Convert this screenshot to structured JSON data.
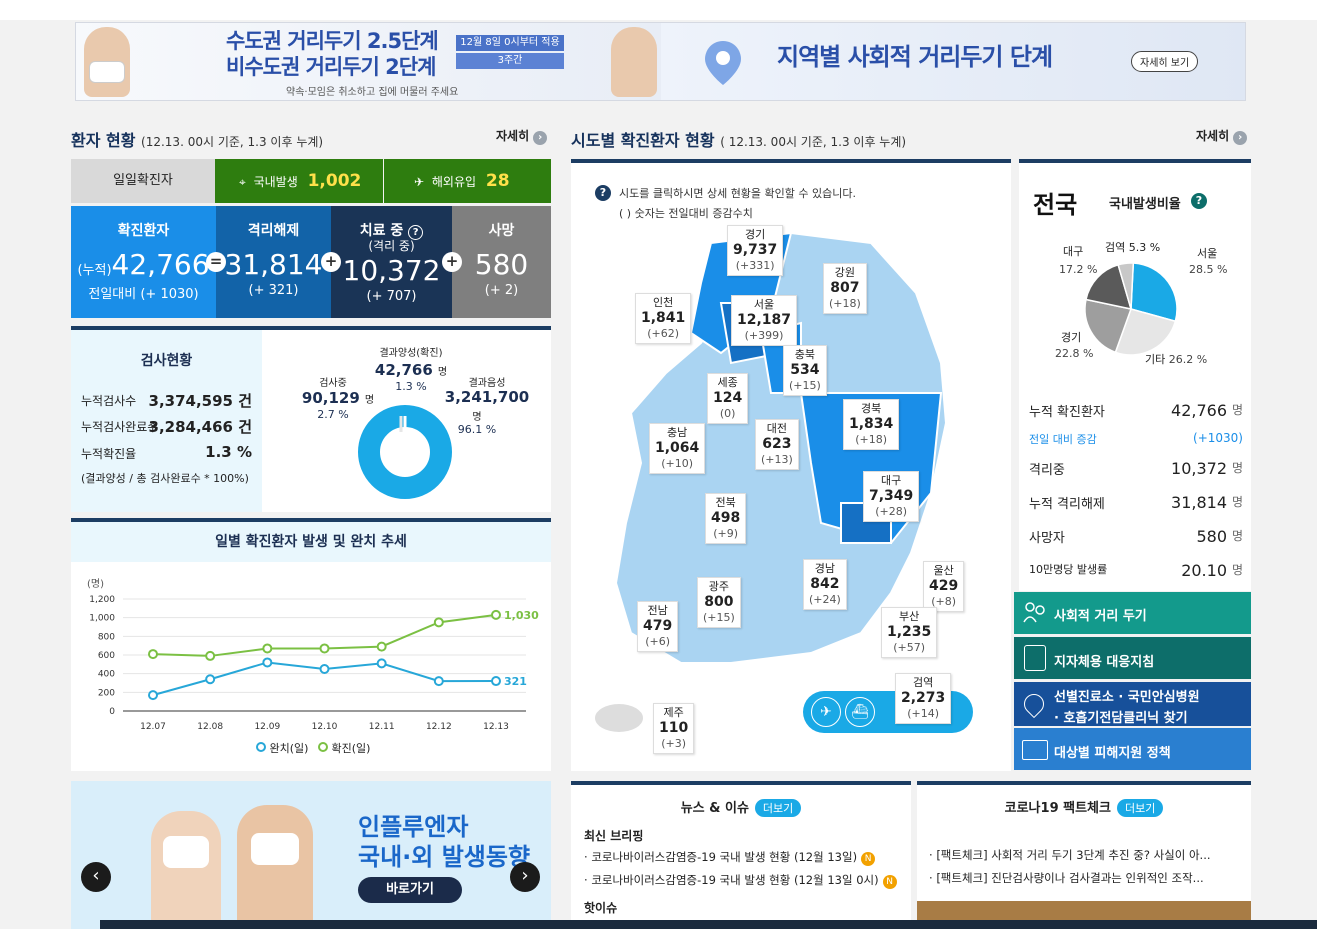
{
  "banner": {
    "left_title_1": "수도권 거리두기 2.5단계",
    "left_title_2": "비수도권 거리두기 2단계",
    "left_subtitle": "약속·모임은 취소하고 집에 머물러 주세요",
    "left_box_1": "12월 8일 0시부터 적용",
    "left_box_2": "3주간",
    "right_title": "지역별 사회적 거리두기 단계",
    "right_more": "자세히 보기"
  },
  "patient_status": {
    "title": "환자 현황",
    "subtitle": "(12.13. 00시 기준, 1.3 이후 누계)",
    "more_label": "자세히",
    "daily_label": "일일확진자",
    "domestic_label": "국내발생",
    "domestic_value": "1,002",
    "imported_label": "해외유입",
    "imported_value": "28",
    "boxes": [
      {
        "head": "확진환자",
        "prefix": "(누적)",
        "value": "42,766",
        "diff": "전일대비 (+ 1030)",
        "color": "#1a8ee8"
      },
      {
        "head": "격리해제",
        "prefix": "",
        "value": "31,814",
        "diff": "(+ 321)",
        "color": "#1263a8"
      },
      {
        "head": "치료 중",
        "sub": "(격리 중)",
        "value": "10,372",
        "diff": "(+ 707)",
        "color": "#1a3456"
      },
      {
        "head": "사망",
        "prefix": "",
        "value": "580",
        "diff": "(+ 2)",
        "color": "#7f7f7f"
      }
    ],
    "operators": [
      "=",
      "+",
      "+"
    ]
  },
  "test_status": {
    "title": "검사현황",
    "rows": [
      {
        "label": "누적검사수",
        "value": "3,374,595 건"
      },
      {
        "label": "누적검사완료수",
        "value": "3,284,466 건"
      },
      {
        "label": "누적확진율",
        "value": "1.3 %"
      }
    ],
    "note": "(결과양성 / 총 검사완료수 * 100%)",
    "testing_label": "검사중",
    "testing_value": "90,129",
    "testing_unit": "명",
    "testing_pct": "2.7 %",
    "positive_label": "결과양성(확진)",
    "positive_value": "42,766",
    "positive_unit": "명",
    "positive_pct": "1.3 %",
    "negative_label": "결과음성",
    "negative_value": "3,241,700",
    "negative_unit": "명",
    "negative_pct": "96.1 %"
  },
  "trend": {
    "title": "일별 확진환자 발생 및 완치 추세",
    "unit": "(명)",
    "legend_recovered": "완치(일)",
    "legend_confirmed": "확진(일)",
    "label_confirmed_last": "1,030",
    "label_recovered_last": "321",
    "y_ticks": [
      "1,200",
      "1,000",
      "800",
      "600",
      "400",
      "200",
      "0"
    ]
  },
  "chart_data": {
    "type": "line",
    "title": "일별 확진환자 발생 및 완치 추세",
    "ylabel": "(명)",
    "xlabel": "",
    "categories": [
      "12.07",
      "12.08",
      "12.09",
      "12.10",
      "12.11",
      "12.12",
      "12.13"
    ],
    "ylim": [
      0,
      1200
    ],
    "series": [
      {
        "name": "완치(일)",
        "values": [
          170,
          340,
          520,
          450,
          510,
          320,
          321
        ],
        "color": "#27a7d8"
      },
      {
        "name": "확진(일)",
        "values": [
          610,
          590,
          670,
          670,
          690,
          950,
          1030
        ],
        "color": "#7bc043"
      }
    ],
    "legend": "bottom",
    "grid": true
  },
  "promo": {
    "title_1": "인플루엔자",
    "title_2": "국내·외 발생동향",
    "button": "바로가기",
    "prev": "‹",
    "next": "›"
  },
  "map_section": {
    "title": "시도별 확진환자 현황",
    "subtitle": "( 12.13. 00시 기준, 1.3 이후 누계)",
    "more_label": "자세히",
    "help_line_1": "시도를 클릭하시면 상세 현황을 확인할 수 있습니다.",
    "help_line_2": "( ) 숫자는 전일대비 증감수치",
    "regions": [
      {
        "name": "경기",
        "value": "9,737",
        "diff": "(+331)"
      },
      {
        "name": "강원",
        "value": "807",
        "diff": "(+18)"
      },
      {
        "name": "인천",
        "value": "1,841",
        "diff": "(+62)"
      },
      {
        "name": "서울",
        "value": "12,187",
        "diff": "(+399)"
      },
      {
        "name": "충북",
        "value": "534",
        "diff": "(+15)"
      },
      {
        "name": "세종",
        "value": "124",
        "diff": "(0)"
      },
      {
        "name": "충남",
        "value": "1,064",
        "diff": "(+10)"
      },
      {
        "name": "대전",
        "value": "623",
        "diff": "(+13)"
      },
      {
        "name": "경북",
        "value": "1,834",
        "diff": "(+18)"
      },
      {
        "name": "대구",
        "value": "7,349",
        "diff": "(+28)"
      },
      {
        "name": "전북",
        "value": "498",
        "diff": "(+9)"
      },
      {
        "name": "경남",
        "value": "842",
        "diff": "(+24)"
      },
      {
        "name": "울산",
        "value": "429",
        "diff": "(+8)"
      },
      {
        "name": "광주",
        "value": "800",
        "diff": "(+15)"
      },
      {
        "name": "부산",
        "value": "1,235",
        "diff": "(+57)"
      },
      {
        "name": "전남",
        "value": "479",
        "diff": "(+6)"
      },
      {
        "name": "제주",
        "value": "110",
        "diff": "(+3)"
      },
      {
        "name": "검역",
        "value": "2,273",
        "diff": "(+14)"
      }
    ]
  },
  "national": {
    "title": "전국",
    "ratio_label": "국내발생비율",
    "pie": [
      {
        "name": "서울",
        "pct": "28.5 %",
        "value": 28.5,
        "color": "#1aa9e6"
      },
      {
        "name": "기타",
        "pct": "26.2 %",
        "value": 26.2,
        "color": "#e6e6e6"
      },
      {
        "name": "경기",
        "pct": "22.8 %",
        "value": 22.8,
        "color": "#9e9e9e"
      },
      {
        "name": "대구",
        "pct": "17.2 %",
        "value": 17.2,
        "color": "#5a5a5a"
      },
      {
        "name": "검역",
        "pct": "5.3 %",
        "value": 5.3,
        "color": "#c8c8c8"
      }
    ],
    "rows": [
      {
        "label": "누적 확진환자",
        "value": "42,766",
        "unit": "명"
      },
      {
        "label": "전일 대비 증감",
        "value": "(+1030)",
        "unit": ""
      },
      {
        "label": "격리중",
        "value": "10,372",
        "unit": "명"
      },
      {
        "label": "누적 격리해제",
        "value": "31,814",
        "unit": "명"
      },
      {
        "label": "사망자",
        "value": "580",
        "unit": "명"
      },
      {
        "label": "10만명당 발생률",
        "value": "20.10",
        "unit": "명"
      }
    ]
  },
  "menu": [
    {
      "label": "사회적 거리 두기",
      "color": "#139a8c",
      "icon": "people-icon"
    },
    {
      "label": "지자체용 대응지침",
      "color": "#0d6e6a",
      "icon": "document-check-icon"
    },
    {
      "label_1": "선별진료소 · 국민안심병원",
      "label_2": "· 호흡기전담클리닉 찾기",
      "color": "#17509a",
      "icon": "map-pin-icon"
    },
    {
      "label": "대상별 피해지원 정책",
      "color": "#2a7fd0",
      "icon": "folder-icon"
    }
  ],
  "news": {
    "title": "뉴스 & 이슈",
    "more": "더보기",
    "section": "최신 브리핑",
    "items": [
      "코로나바이러스감염증-19 국내 발생 현황 (12월 13일)",
      "코로나바이러스감염증-19 국내 발생 현황 (12월 13일 0시)"
    ],
    "badge": "N",
    "section_2": "핫이슈"
  },
  "factcheck": {
    "title": "코로나19 팩트체크",
    "more": "더보기",
    "items": [
      "[팩트체크] 사회적 거리 두기 3단계 추진 중? 사실이 아...",
      "[팩트체크] 진단검사량이나 검사결과는 인위적인 조작..."
    ]
  }
}
